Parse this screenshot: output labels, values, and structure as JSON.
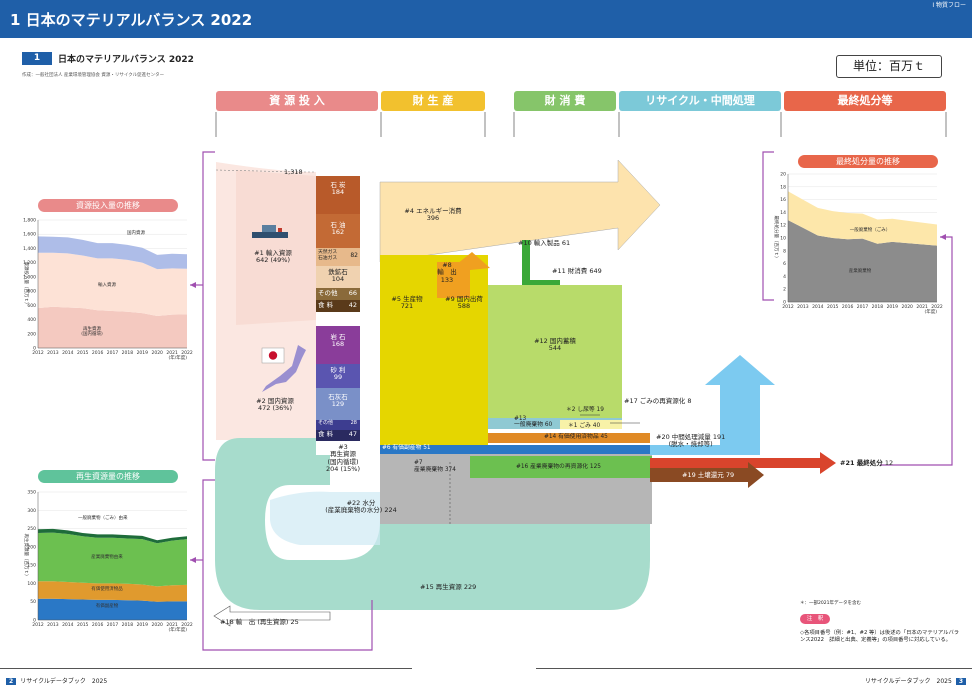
{
  "header": {
    "title": "1 日本のマテリアルバランス 2022",
    "corner": "I 物質フロー"
  },
  "section": {
    "number": "1",
    "title": "日本のマテリアルバランス 2022",
    "credit": "作成：一般社団法人 産業環境管理協会 資源・リサイクル促進センター"
  },
  "unit": "単位：百万ｔ",
  "categories": [
    "資 源 投 入",
    "財 生 産",
    "財 消 費",
    "リサイクル・中間処理",
    "最終処分等"
  ],
  "flow": {
    "total": "1,318",
    "import_label": "#1 輸入資源",
    "import_value": "642 (49%)",
    "domestic_label": "#2 国内資源",
    "domestic_value": "472 (36%)",
    "stack": [
      {
        "name": "石 炭",
        "value": "184"
      },
      {
        "name": "石 油",
        "value": "162"
      },
      {
        "name": "天然ガス\n石油ガス",
        "value": "82"
      },
      {
        "name": "鉄鉱石",
        "value": "104"
      },
      {
        "name": "その他",
        "value": "66"
      },
      {
        "name": "食 料",
        "value": "42"
      },
      {
        "name": "岩 石",
        "value": "168"
      },
      {
        "name": "砂 利",
        "value": "99"
      },
      {
        "name": "石灰石",
        "value": "129"
      },
      {
        "name": "その他",
        "value": "28"
      },
      {
        "name": "食 料",
        "value": "47"
      }
    ],
    "recycled_label": "#3\n再生資源\n(国内循環)",
    "recycled_value": "204 (15%)",
    "energy_label": "#4 エネルギー消費",
    "energy_value": "396",
    "production_label": "#5 生産物",
    "production_value": "721",
    "export_label": "#8\n輸　出",
    "export_value": "133",
    "domestic_ship_label": "#9 国内出荷",
    "domestic_ship_value": "588",
    "import_products": "#10 輸入製品 61",
    "domestic_consumption": "#11 財消費 649",
    "stock_label": "#12 国内蓄積",
    "stock_value": "544",
    "f13_label": "#13\n一般廃棄物 60",
    "s1_label": "＊1 ごみ 40",
    "s2_label": "＊2 し尿等 19",
    "f14_label": "#14 有価使用済物品 45",
    "f6_label": "#6 有価副産物 51",
    "f7_label": "#7\n産業廃棄物 374",
    "f16_label": "#16 産業廃棄物の再資源化 125",
    "f17_label": "#17 ごみの再資源化 8",
    "f20_label": "#20 中間処理減量 191\n(脱水・焼却等)",
    "f19_label": "#19 土壌還元 79",
    "f21_label": "#21 最終処分",
    "f21_value": "12",
    "f22_label": "#22 水分\n(産業廃棄物の水分) 224",
    "f15_label": "#15 再生資源 229",
    "f18_label": "#18 輸　出 (再生資源) 25"
  },
  "charts": {
    "input": {
      "title": "資源投入量の推移",
      "ylabel": "資源投入量（百万ｔ）",
      "ylim": [
        0,
        1800
      ],
      "yticks": [
        "1,800",
        "1,600",
        "1,400",
        "1,200",
        "1,000",
        "800",
        "600",
        "400",
        "200",
        "0"
      ],
      "xunit": "(年/年度)",
      "legend": [
        "再生資源\n(国内循環)",
        "輸入資源",
        "国内資源"
      ]
    },
    "recycle": {
      "title": "再生資源量の推移",
      "ylabel": "再生資源量（百万ｔ）",
      "ylim": [
        0,
        350
      ],
      "yticks": [
        "350",
        "300",
        "250",
        "200",
        "150",
        "100",
        "50",
        "0"
      ],
      "xunit": "(年/年度)",
      "legend": [
        "一般廃棄物（ごみ）由来",
        "産業廃棄物由来",
        "有価使用済物品",
        "有価副産物"
      ]
    },
    "disposal": {
      "title": "最終処分量の推移",
      "ylabel": "最終処分量（百万ｔ）",
      "ylim": [
        0,
        20
      ],
      "yticks": [
        "20",
        "18",
        "16",
        "14",
        "12",
        "10",
        "8",
        "6",
        "4",
        "2",
        "0"
      ],
      "xunit": "(年度)",
      "legend": [
        "一般廃棄物（ごみ）",
        "産業廃棄物"
      ]
    },
    "years": [
      "2012",
      "2013",
      "2014",
      "2015",
      "2016",
      "2017",
      "2018",
      "2019",
      "2020",
      "2021",
      "2022"
    ]
  },
  "notes": {
    "star": "＊：一部2021年データを含む",
    "note_badge": "注　釈",
    "note_text": "◇各項目番号（例：#1、#2 等）は後述の「日本のマテリアルバランス2022　詳細と出典、定義等」の項目番号に対応している。"
  },
  "footer": {
    "left_page": "2",
    "left_text": "リサイクルデータブック　2025",
    "right_page": "3",
    "right_text": "リサイクルデータブック　2025"
  },
  "colors": {
    "header": "#1f5fa8",
    "input": "#e98a8a",
    "production": "#f2c12e",
    "consumption": "#86c56a",
    "recycle": "#7cc9d8",
    "disposal": "#e8664a"
  }
}
